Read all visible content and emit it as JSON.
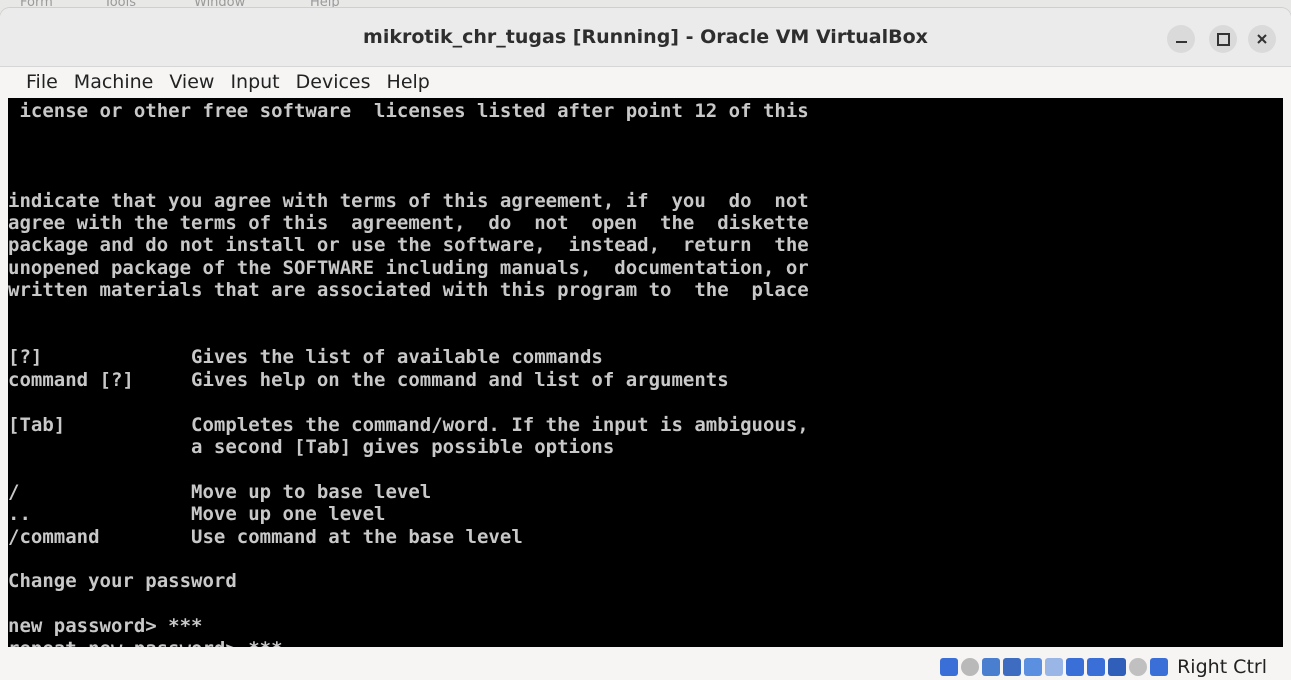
{
  "background_menu": [
    "Form",
    "Tools",
    "Window",
    "Help"
  ],
  "window": {
    "title": "mikrotik_chr_tugas [Running] - Oracle VM VirtualBox"
  },
  "menubar": {
    "items": [
      "File",
      "Machine",
      "View",
      "Input",
      "Devices",
      "Help"
    ]
  },
  "terminal": {
    "lines": [
      " icense or other free software  licenses listed after point 12 of this",
      "",
      "",
      "",
      "indicate that you agree with terms of this agreement, if  you  do  not",
      "agree with the terms of this  agreement,  do  not  open  the  diskette",
      "package and do not install or use the software,  instead,  return  the",
      "unopened package of the SOFTWARE including manuals,  documentation, or",
      "written materials that are associated with this program to  the  place",
      "",
      "",
      "[?]             Gives the list of available commands",
      "command [?]     Gives help on the command and list of arguments",
      "",
      "[Tab]           Completes the command/word. If the input is ambiguous,",
      "                a second [Tab] gives possible options",
      "",
      "/               Move up to base level",
      "..              Move up one level",
      "/command        Use command at the base level",
      "",
      "Change your password",
      "",
      "new password> ***",
      "repeat new password> ***_"
    ]
  },
  "statusbar": {
    "host_key_label": "Right Ctrl",
    "icons": [
      {
        "name": "hard-disk-icon",
        "color": "#3a6fd8"
      },
      {
        "name": "optical-drive-icon",
        "color": "#b9b9b9"
      },
      {
        "name": "audio-icon",
        "color": "#4a7fd0"
      },
      {
        "name": "network-icon",
        "color": "#3d6cc0"
      },
      {
        "name": "usb-icon",
        "color": "#5b8fe0"
      },
      {
        "name": "shared-folders-icon",
        "color": "#9ab6e6"
      },
      {
        "name": "display-icon",
        "color": "#3a6fd8"
      },
      {
        "name": "recording-icon",
        "color": "#3a6fd8"
      },
      {
        "name": "cpu-icon",
        "color": "#2f5fb8"
      },
      {
        "name": "mouse-integration-icon",
        "color": "#c0c0c0"
      },
      {
        "name": "keyboard-capture-icon",
        "color": "#3a6fd8"
      }
    ]
  }
}
